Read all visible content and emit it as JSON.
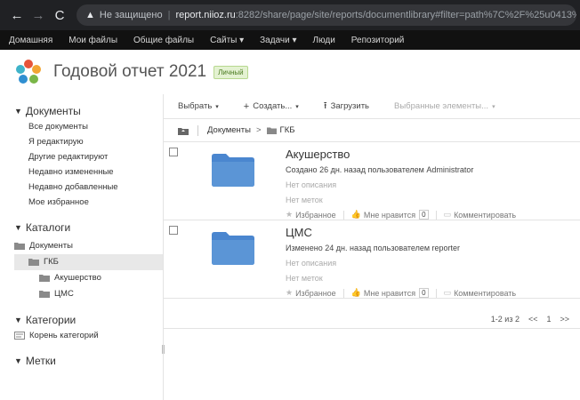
{
  "browser": {
    "back": "←",
    "forward": "→",
    "reload": "C",
    "warning_icon": "▲",
    "insecure_label": "Не защищено",
    "separator": "|",
    "url_host": "report.niioz.ru",
    "url_rest": ":8282/share/page/site/reports/documentlibrary#filter=path%7C%2F%25u0413%25u"
  },
  "app_nav": {
    "items": [
      "Домашняя",
      "Мои файлы",
      "Общие файлы",
      "Сайты ▾",
      "Задачи ▾",
      "Люди",
      "Репозиторий"
    ]
  },
  "site": {
    "title": "Годовой отчет 2021",
    "badge": "Личный"
  },
  "sidebar": {
    "documents_header": "Документы",
    "documents_links": [
      "Все документы",
      "Я редактирую",
      "Другие редактируют",
      "Недавно измененные",
      "Недавно добавленные",
      "Мое избранное"
    ],
    "catalogs_header": "Каталоги",
    "tree": [
      "Документы",
      "ГКБ",
      "Акушерство",
      "ЦМС"
    ],
    "categories_header": "Категории",
    "categories_root": "Корень категорий",
    "tags_header": "Метки",
    "triangle": "▼"
  },
  "toolbar": {
    "select": "Выбрать",
    "create": "Создать...",
    "upload": "Загрузить",
    "selected": "Выбранные элементы...",
    "caret": "▾",
    "plus": "+",
    "upload_icon": "⭱"
  },
  "breadcrumb": {
    "root": "Документы",
    "arrow": ">",
    "current": "ГКБ"
  },
  "rows": [
    {
      "name": "Акушерство",
      "meta": "Создано 26 дн. назад пользователем Administrator",
      "description": "Нет описания",
      "tags": "Нет меток",
      "favorite": "Избранное",
      "like": "Мне нравится",
      "like_count": "0",
      "comment": "Комментировать"
    },
    {
      "name": "ЦМС",
      "meta": "Изменено 24 дн. назад пользователем reporter",
      "description": "Нет описания",
      "tags": "Нет меток",
      "favorite": "Избранное",
      "like": "Мне нравится",
      "like_count": "0",
      "comment": "Комментировать"
    }
  ],
  "pagination": {
    "range": "1-2 из 2",
    "first": "<<",
    "page": "1",
    "last": ">>"
  },
  "icons": {
    "star": "★",
    "thumb": "👍",
    "comment": "▭"
  },
  "colors": {
    "folder_blue": "#5b95d6",
    "browser_bg": "#202124",
    "nav_bg": "#111111"
  }
}
